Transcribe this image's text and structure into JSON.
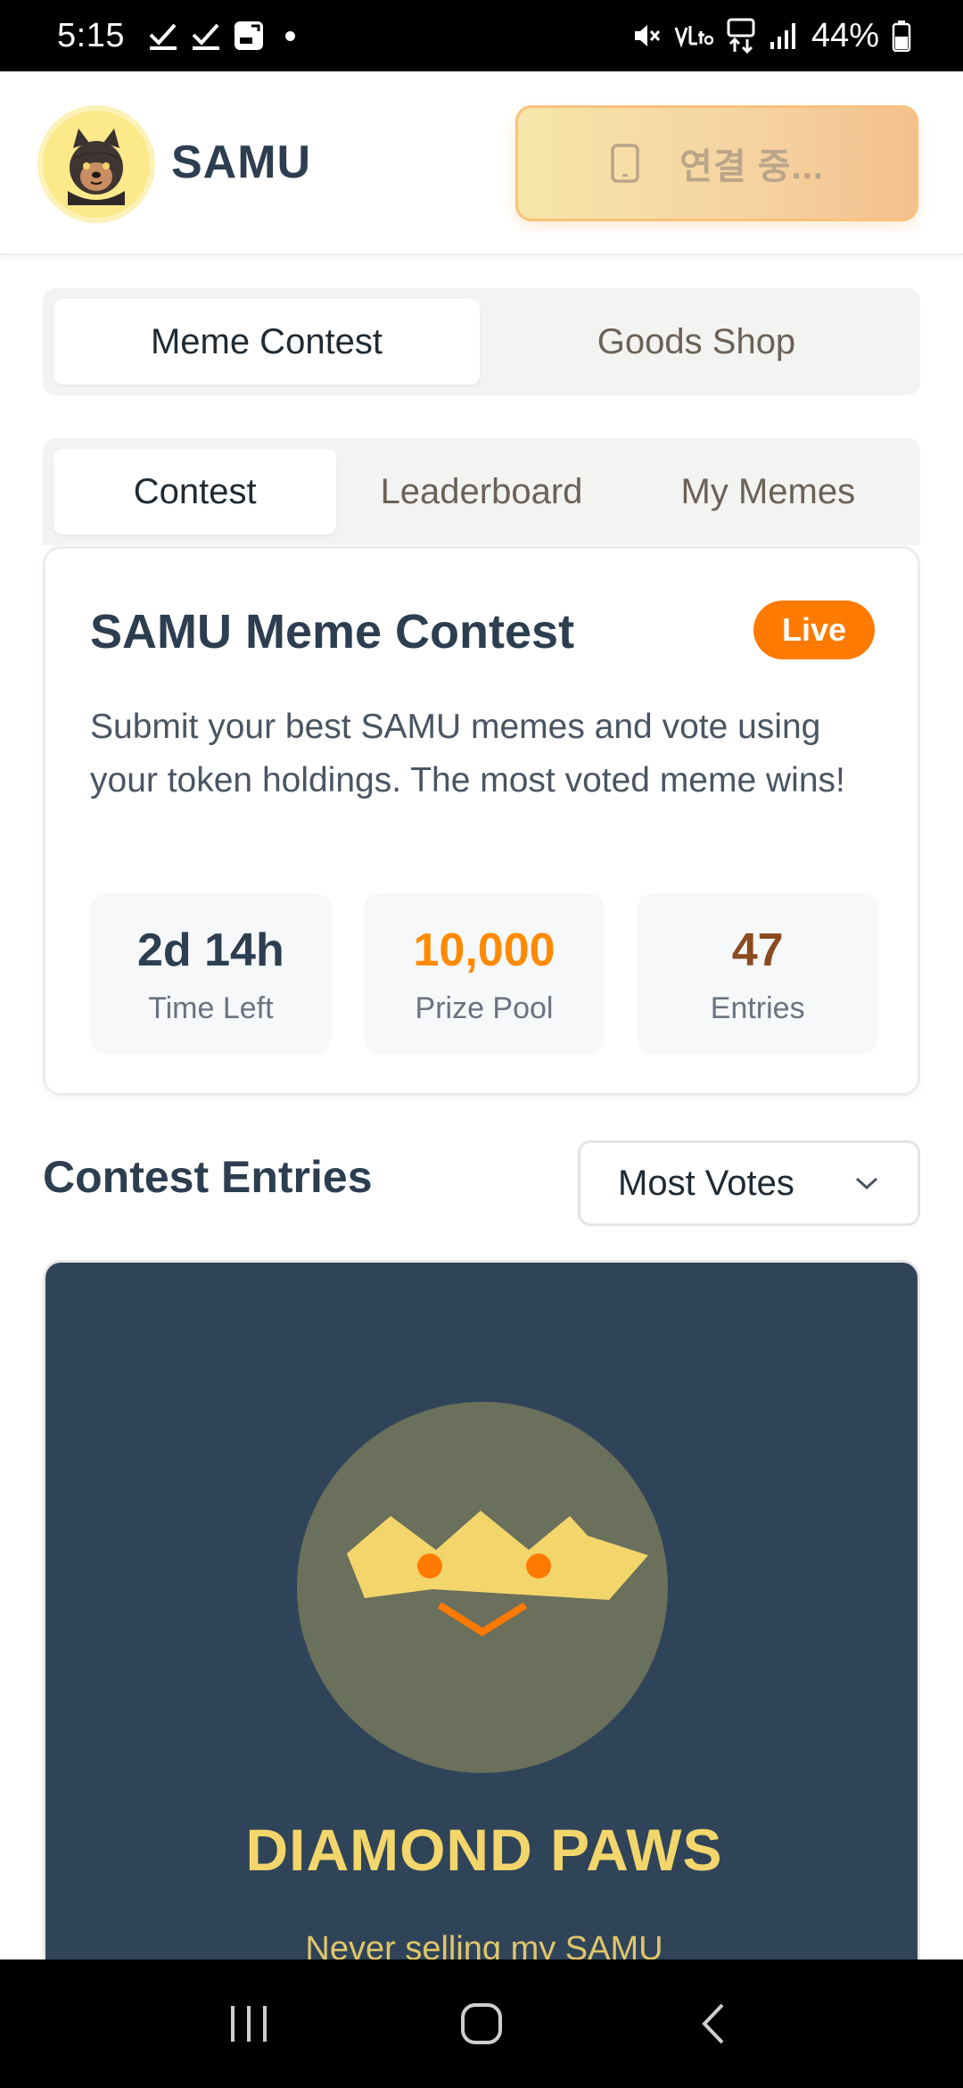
{
  "status_bar": {
    "time": "5:15",
    "battery": "44%"
  },
  "header": {
    "brand": "SAMU",
    "connect_label": "연결 중..."
  },
  "main_tabs": [
    {
      "label": "Meme Contest",
      "active": true
    },
    {
      "label": "Goods Shop",
      "active": false
    }
  ],
  "sub_tabs": [
    {
      "label": "Contest",
      "active": true
    },
    {
      "label": "Leaderboard",
      "active": false
    },
    {
      "label": "My Memes",
      "active": false
    }
  ],
  "contest": {
    "title": "SAMU Meme Contest",
    "badge": "Live",
    "description": "Submit your best SAMU memes and vote using your token holdings. The most voted meme wins!",
    "stats": [
      {
        "value": "2d 14h",
        "label": "Time Left",
        "color": "#2c3e50"
      },
      {
        "value": "10,000",
        "label": "Prize Pool",
        "color": "#ff8a00"
      },
      {
        "value": "47",
        "label": "Entries",
        "color": "#8b4a1f"
      }
    ]
  },
  "entries": {
    "title": "Contest Entries",
    "sort_value": "Most Votes"
  },
  "meme": {
    "title": "DIAMOND PAWS",
    "caption": "Never selling my SAMU"
  },
  "colors": {
    "accent_orange": "#ff7a00",
    "dark_navy": "#2c3e50",
    "meme_bg": "#304459",
    "meme_gold": "#f3d66b"
  }
}
